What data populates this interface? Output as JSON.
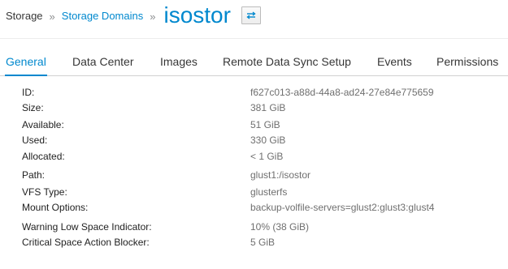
{
  "breadcrumb": {
    "root": "Storage",
    "separator": "»",
    "section": "Storage Domains",
    "current": "isostor",
    "sync_icon": "sync-arrows-icon"
  },
  "tabs": [
    {
      "label": "General",
      "active": true
    },
    {
      "label": "Data Center",
      "active": false
    },
    {
      "label": "Images",
      "active": false
    },
    {
      "label": "Remote Data Sync Setup",
      "active": false
    },
    {
      "label": "Events",
      "active": false
    },
    {
      "label": "Permissions",
      "active": false
    }
  ],
  "details": [
    {
      "label": "ID:",
      "value": "f627c013-a88d-44a8-ad24-27e84e775659"
    },
    {
      "label": "Size:",
      "value": "381 GiB"
    },
    {
      "label": "Available:",
      "value": "51 GiB"
    },
    {
      "label": "Used:",
      "value": "330 GiB"
    },
    {
      "label": "Allocated:",
      "value": "< 1 GiB"
    },
    {
      "label": "Path:",
      "value": "glust1:/isostor"
    },
    {
      "label": "VFS Type:",
      "value": "glusterfs"
    },
    {
      "label": "Mount Options:",
      "value": "backup-volfile-servers=glust2:glust3:glust4"
    },
    {
      "label": "Warning Low Space Indicator:",
      "value": "10% (38 GiB)"
    },
    {
      "label": "Critical Space Action Blocker:",
      "value": "5 GiB"
    }
  ],
  "colors": {
    "accent": "#0088ce",
    "label_text": "#1f1f1f",
    "value_text": "#6f6f6f"
  }
}
